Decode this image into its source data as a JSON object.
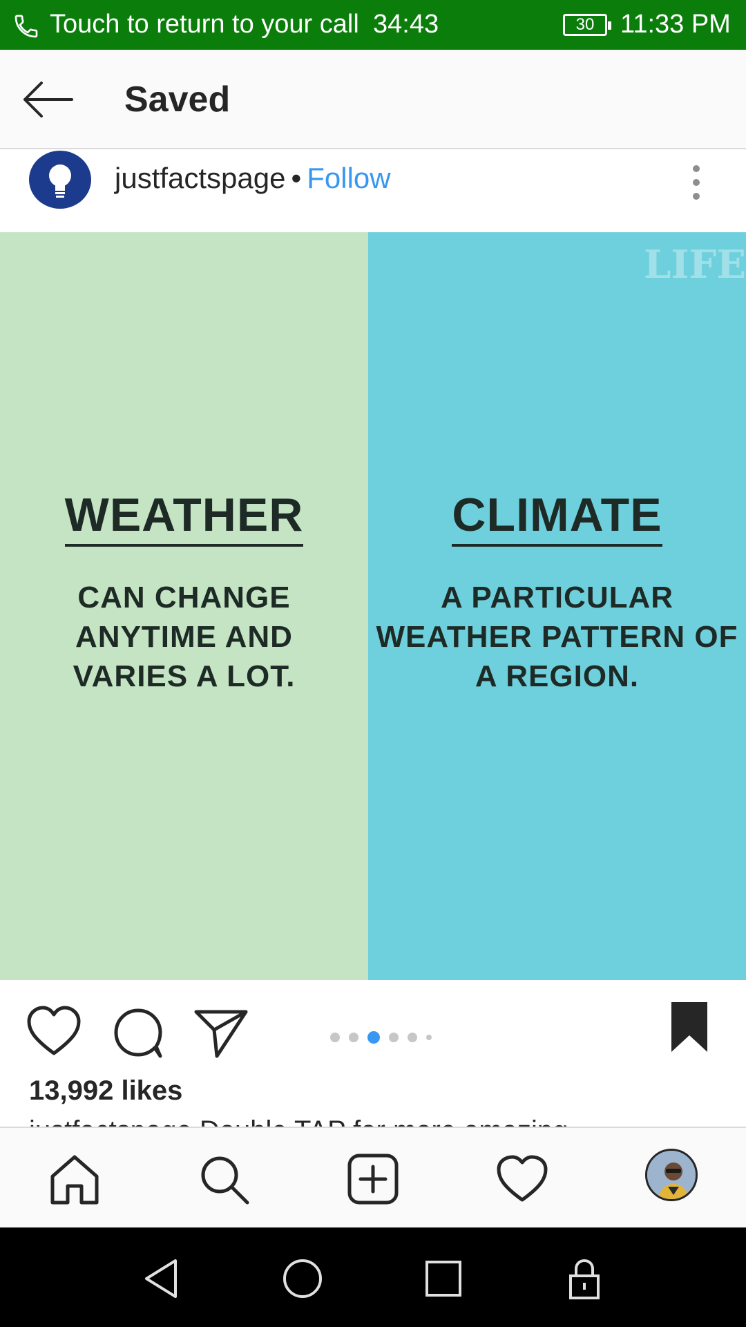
{
  "status_bar": {
    "call_text": "Touch to return to your call",
    "call_timer": "34:43",
    "battery": "30",
    "time": "11:33 PM",
    "background_color": "#0b7d0b"
  },
  "header": {
    "title": "Saved",
    "back_icon": "arrow-left-icon"
  },
  "post": {
    "username": "justfactspage",
    "separator": "•",
    "follow_label": "Follow",
    "more_icon": "more-vertical-icon",
    "image": {
      "left_heading": "WEATHER",
      "left_body": "CAN CHANGE ANYTIME AND VARIES A LOT.",
      "right_heading": "CLIMATE",
      "right_body": "A PARTICULAR WEATHER PATTERN OF A REGION.",
      "watermark": "LIFE"
    },
    "carousel": {
      "count": 6,
      "active_index": 2
    },
    "likes": "13,992 likes",
    "caption_peek": "justfactspage Double TAP for more amazing"
  },
  "actions": {
    "like_icon": "heart-icon",
    "comment_icon": "comment-icon",
    "share_icon": "send-icon",
    "save_icon": "bookmark-filled-icon"
  },
  "tabbar": {
    "items": [
      "home-icon",
      "search-icon",
      "new-post-icon",
      "activity-heart-icon",
      "profile-avatar"
    ]
  },
  "navbar": {
    "items": [
      "back-triangle-icon",
      "home-circle-icon",
      "recents-square-icon",
      "lock-icon"
    ]
  },
  "colors": {
    "accent": "#3897f0",
    "left_panel": "#c4e4c3",
    "right_panel": "#6fd0dd"
  }
}
